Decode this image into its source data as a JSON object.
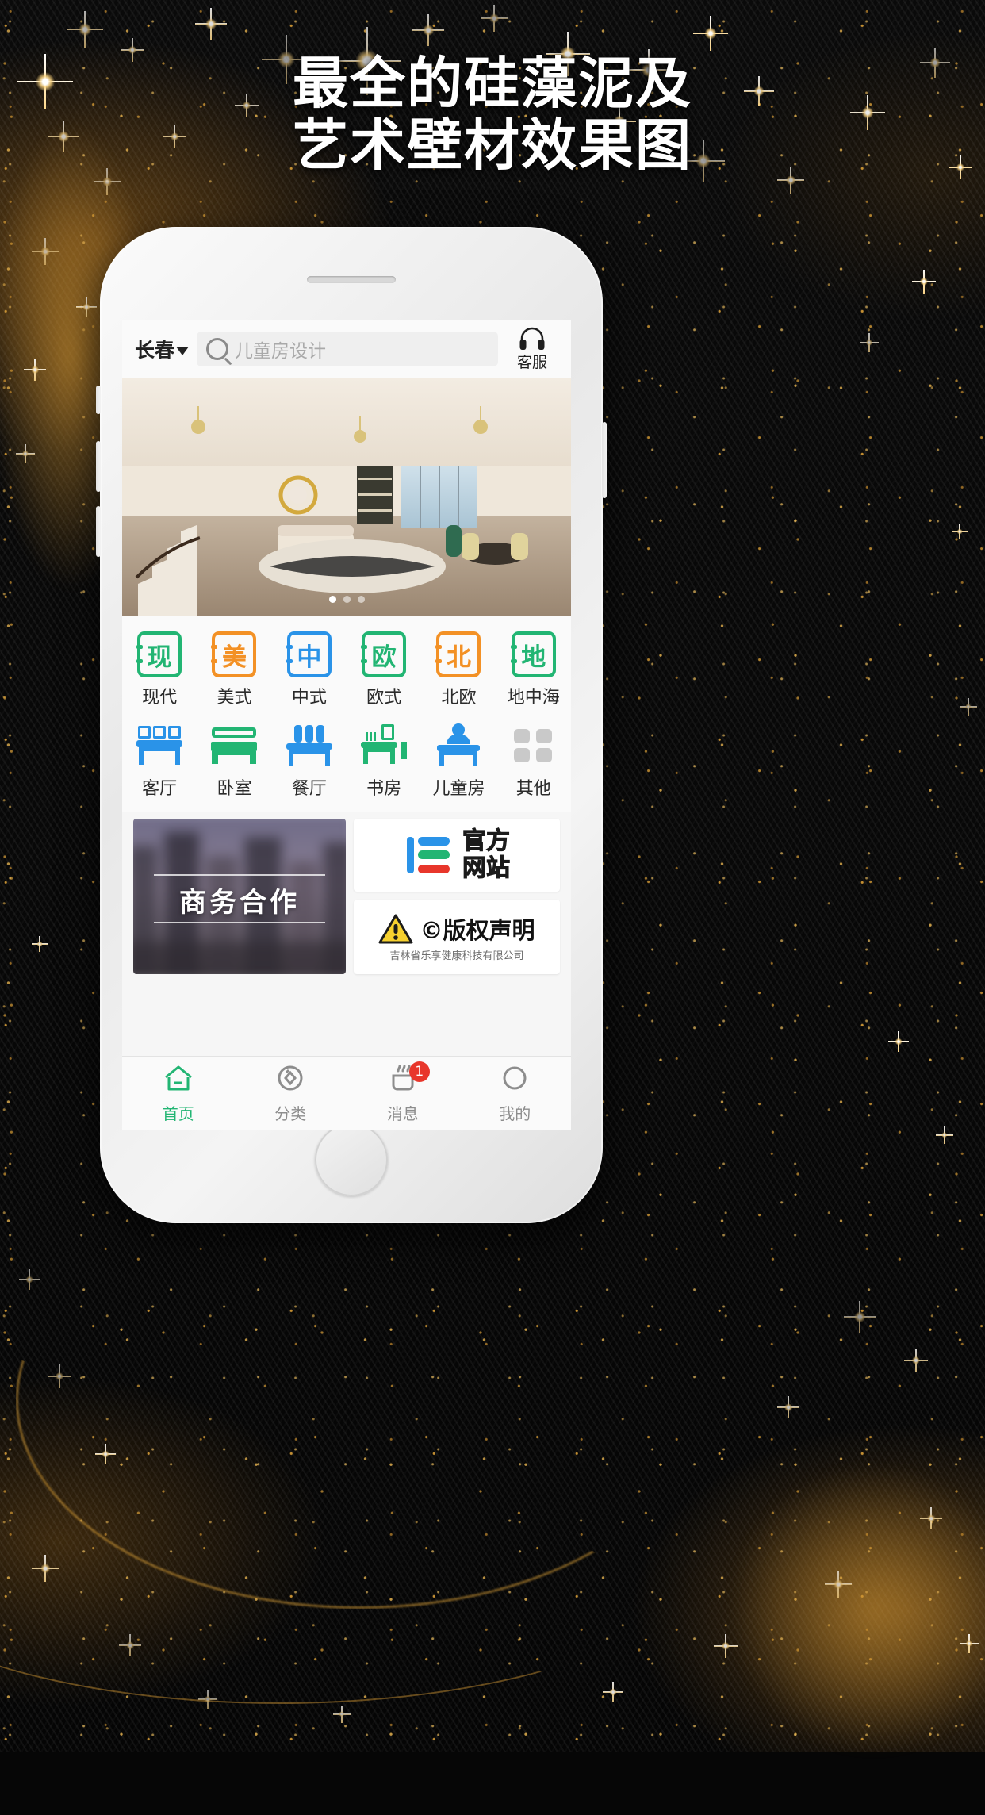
{
  "poster": {
    "headline_line1": "最全的硅藻泥及",
    "headline_line2": "艺术壁材效果图",
    "bg_color": "#060606",
    "gold_color": "#cd9232"
  },
  "app": {
    "topbar": {
      "city": "长春",
      "city_caret": "chevron-down-icon",
      "search_placeholder": "儿童房设计",
      "search_value": "",
      "service_label": "客服",
      "service_icon": "headset-icon"
    },
    "hero": {
      "alt": "panoramic-living-room",
      "dots_total": 3,
      "dot_active_index": 0
    },
    "styles": [
      {
        "label": "现代",
        "glyph": "现",
        "color": "#22b573"
      },
      {
        "label": "美式",
        "glyph": "美",
        "color": "#f39125"
      },
      {
        "label": "中式",
        "glyph": "中",
        "color": "#2a93e8"
      },
      {
        "label": "欧式",
        "glyph": "欧",
        "color": "#22b573"
      },
      {
        "label": "北欧",
        "glyph": "北",
        "color": "#f39125"
      },
      {
        "label": "地中海",
        "glyph": "地",
        "color": "#22b573"
      }
    ],
    "rooms": [
      {
        "label": "客厅",
        "icon": "sofa-icon",
        "color": "#2a93e8"
      },
      {
        "label": "卧室",
        "icon": "bed-icon",
        "color": "#22b573"
      },
      {
        "label": "餐厅",
        "icon": "dining-icon",
        "color": "#2a93e8"
      },
      {
        "label": "书房",
        "icon": "desk-icon",
        "color": "#22b573"
      },
      {
        "label": "儿童房",
        "icon": "kid-chair-icon",
        "color": "#2a93e8"
      },
      {
        "label": "其他",
        "icon": "grid-icon",
        "color": "#c9c9c9"
      }
    ],
    "promo": {
      "business_title": "商务合作",
      "official_site": {
        "line1": "官方",
        "line2": "网站",
        "logo": "baidu-logo-icon"
      },
      "copyright": {
        "title": "©版权声明",
        "company": "吉林省乐享健康科技有限公司",
        "icon": "warning-triangle-icon"
      }
    },
    "tabs": [
      {
        "label": "首页",
        "icon": "home-icon",
        "active": true,
        "badge": ""
      },
      {
        "label": "分类",
        "icon": "category-icon",
        "active": false,
        "badge": ""
      },
      {
        "label": "消息",
        "icon": "message-icon",
        "active": false,
        "badge": "1"
      },
      {
        "label": "我的",
        "icon": "profile-icon",
        "active": false,
        "badge": ""
      }
    ],
    "accent_color": "#22b573",
    "badge_color": "#e8362b"
  }
}
